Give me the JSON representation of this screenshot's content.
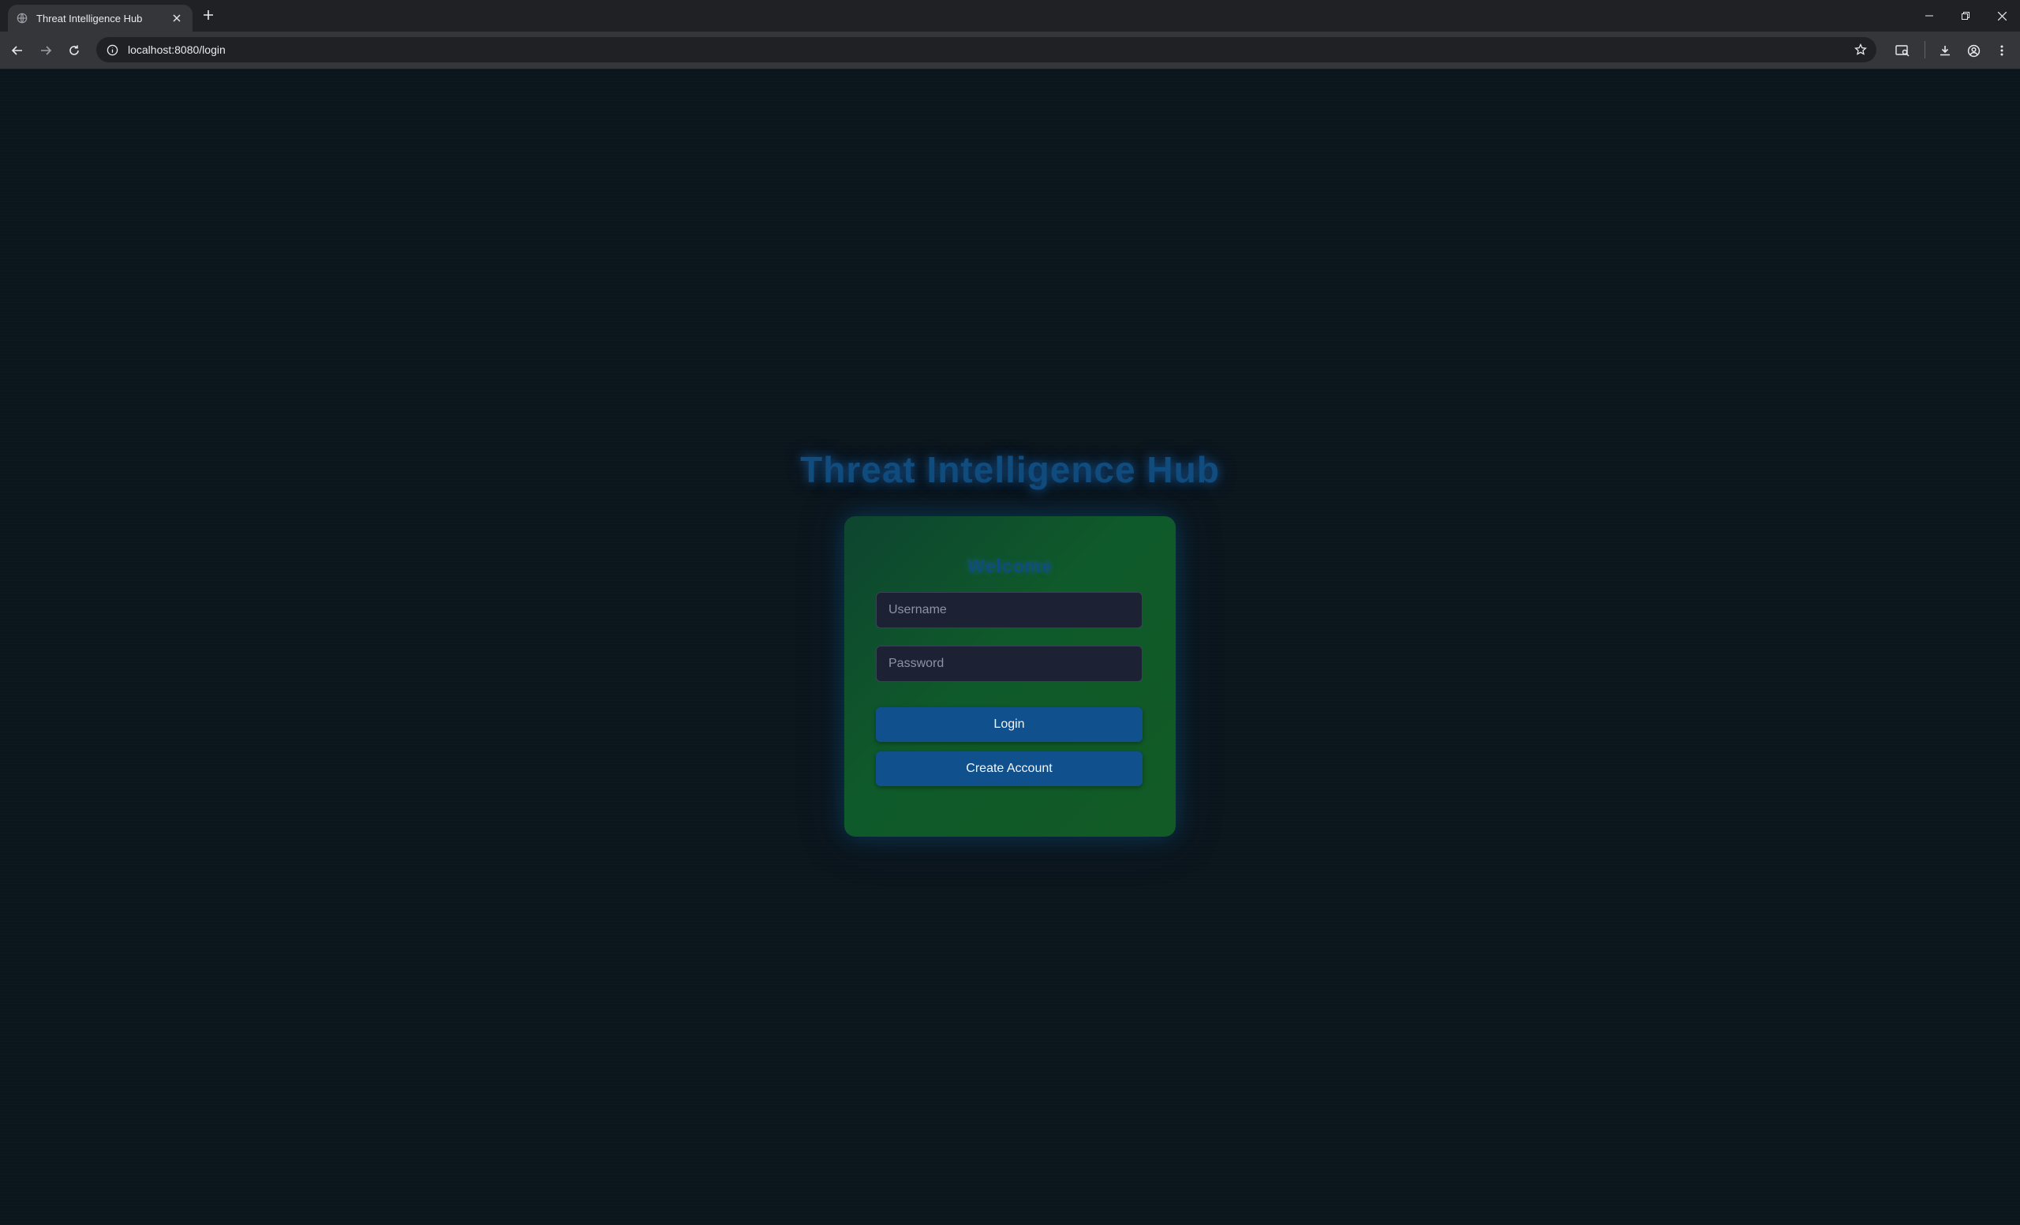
{
  "browser": {
    "tab_title": "Threat Intelligence Hub",
    "url": "localhost:8080/login",
    "icons": {
      "favicon": "globe-icon",
      "tab_close": "close-icon",
      "new_tab": "plus-icon",
      "back": "arrow-left-icon",
      "forward": "arrow-right-icon",
      "reload": "reload-icon",
      "site_info": "info-icon",
      "bookmark": "star-icon",
      "reading_mode": "reading-mode-icon",
      "downloads": "download-icon",
      "profile": "profile-icon",
      "menu": "kebab-menu-icon"
    }
  },
  "page": {
    "app_title": "Threat Intelligence Hub",
    "card": {
      "heading": "Welcome",
      "username_placeholder": "Username",
      "password_placeholder": "Password",
      "login_label": "Login",
      "create_account_label": "Create Account"
    },
    "colors": {
      "background": "#0b151c",
      "title": "#114c7e",
      "card_green": "#0f5a2a",
      "button_blue": "#10508c",
      "input_bg": "#1c2233"
    }
  }
}
